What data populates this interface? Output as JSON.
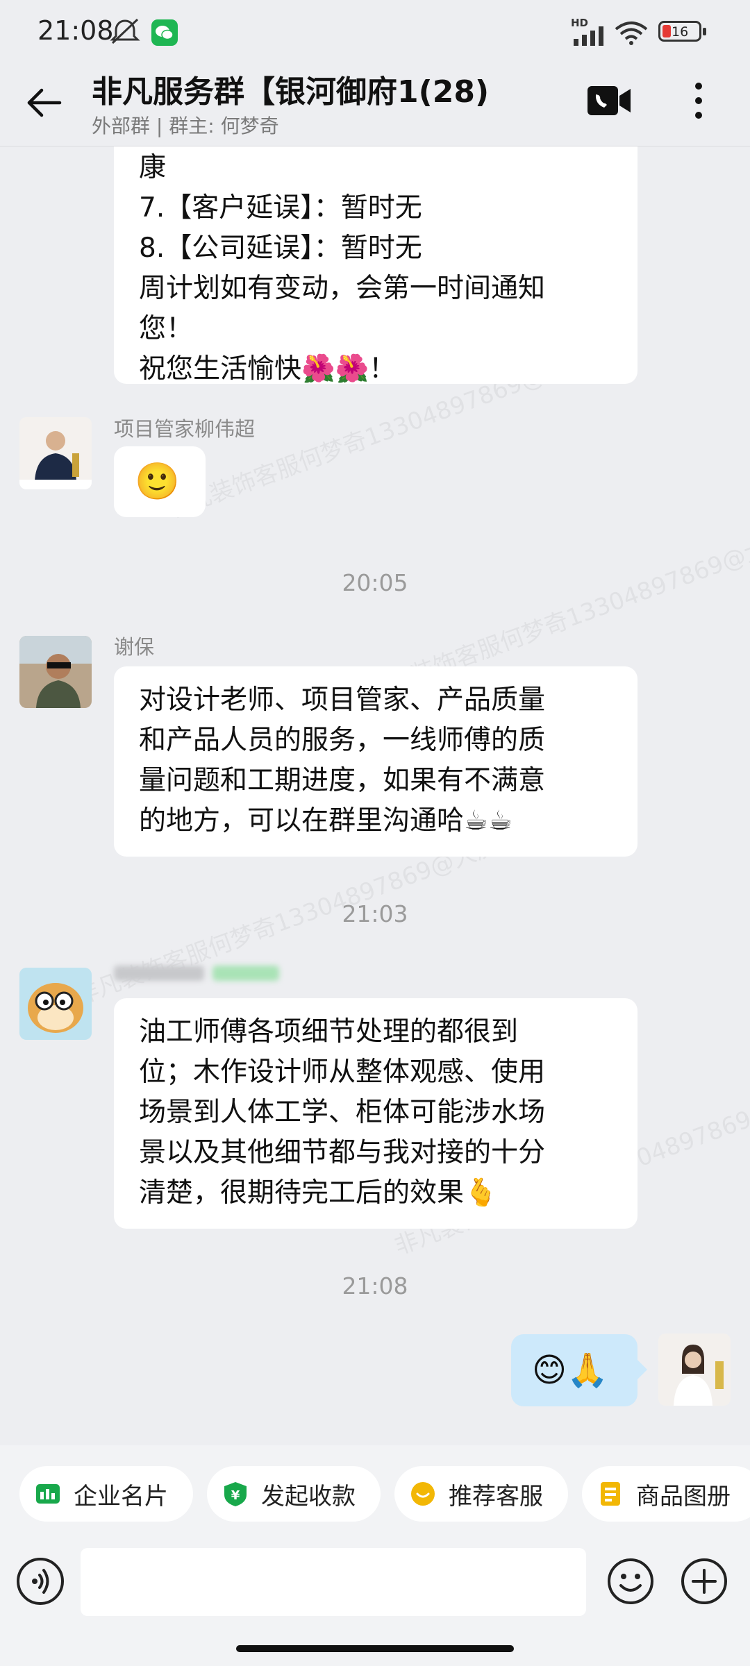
{
  "status_bar": {
    "time": "21:08",
    "network_label": "HD",
    "battery_level": "16"
  },
  "header": {
    "title": "非凡服务群【银河御府1(28)",
    "subtitle": "外部群 | 群主: 何梦奇"
  },
  "messages": {
    "m1_lines": [
      "康",
      "7.【客户延误】：暂时无",
      "8.【公司延误】：暂时无",
      "周计划如有变动，会第一时间通知",
      "您！",
      "祝您生活愉快🌺🌺！"
    ],
    "m2_sender": "项目管家柳伟超",
    "m2_emoji": "🙂",
    "time1": "20:05",
    "m3_sender": "谢保",
    "m3_lines": [
      "对设计老师、项目管家、产品质量",
      "和产品人员的服务，一线师傅的质",
      "量问题和工期进度，如果有不满意",
      "的地方，可以在群里沟通哈☕☕"
    ],
    "time2": "21:03",
    "m4_lines": [
      "油工师傅各项细节处理的都很到",
      "位；木作设计师从整体观感、使用",
      "场景到人体工学、柜体可能涉水场",
      "景以及其他细节都与我对接的十分",
      "清楚，很期待完工后的效果🫰"
    ],
    "time3": "21:08",
    "m5_text": "😊🙏"
  },
  "watermark": "非凡装饰客服何梦奇13304897869@大庆",
  "quick_actions": [
    "企业名片",
    "发起收款",
    "推荐客服",
    "商品图册"
  ],
  "input": {
    "placeholder": ""
  }
}
